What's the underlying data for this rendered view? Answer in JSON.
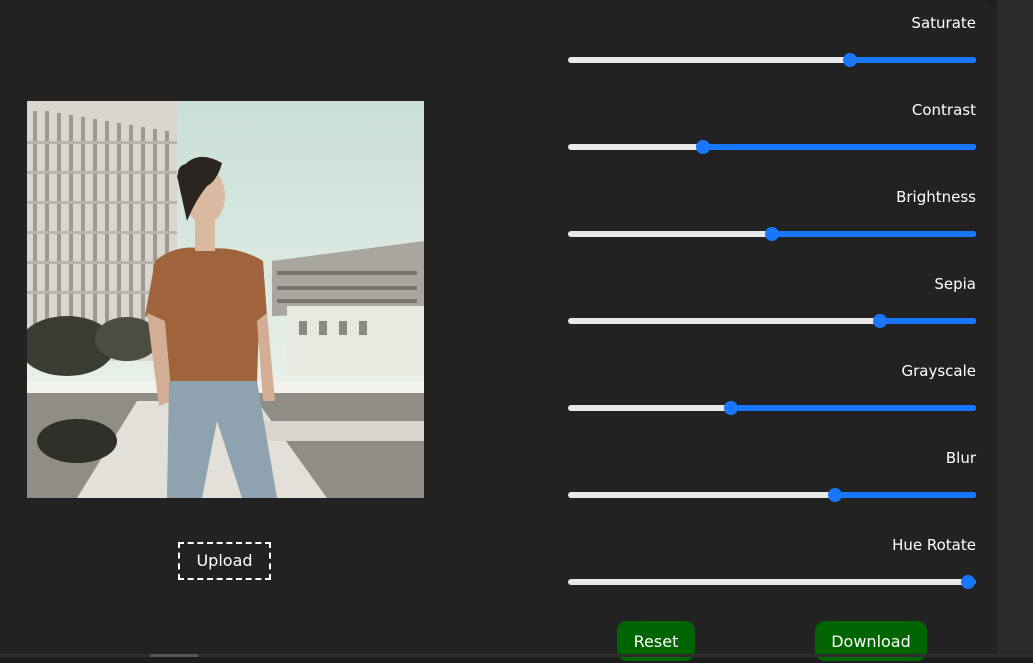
{
  "upload": {
    "label": "Upload"
  },
  "controls": [
    {
      "label": "Saturate",
      "value_fraction": 0.69
    },
    {
      "label": "Contrast",
      "value_fraction": 0.33
    },
    {
      "label": "Brightness",
      "value_fraction": 0.5
    },
    {
      "label": "Sepia",
      "value_fraction": 0.765
    },
    {
      "label": "Grayscale",
      "value_fraction": 0.4
    },
    {
      "label": "Blur",
      "value_fraction": 0.655
    },
    {
      "label": "Hue Rotate",
      "value_fraction": 0.98
    }
  ],
  "actions": {
    "reset_label": "Reset",
    "download_label": "Download"
  },
  "colors": {
    "accent": "#1976ff",
    "action_bg": "#006400",
    "panel_bg": "#222222"
  }
}
